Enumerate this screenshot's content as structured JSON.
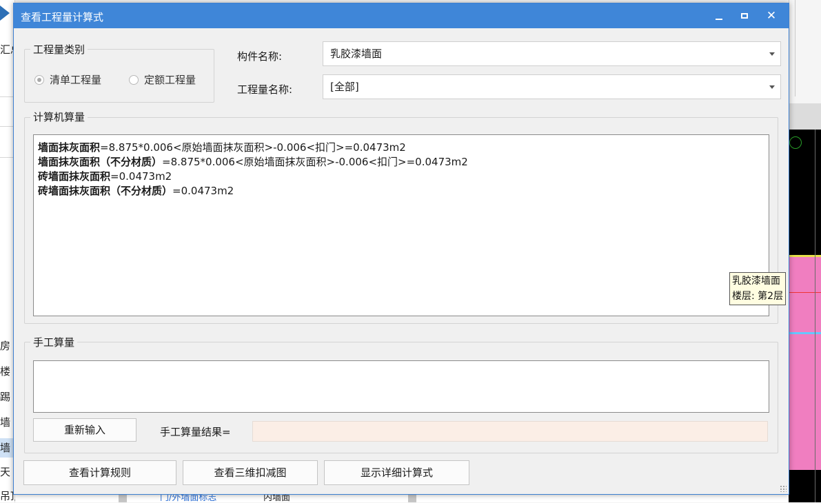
{
  "dialog": {
    "title": "查看工程量计算式",
    "controls": {
      "minimize": "minimize",
      "maximize": "maximize",
      "close": "✕"
    }
  },
  "quantity_type": {
    "group_label": "工程量类别",
    "options": [
      {
        "label": "清单工程量",
        "selected": true
      },
      {
        "label": "定额工程量",
        "selected": false
      }
    ]
  },
  "component_name": {
    "label": "构件名称:",
    "value": "乳胶漆墙面"
  },
  "quantity_name": {
    "label": "工程量名称:",
    "value": "[全部]"
  },
  "computer_calc": {
    "group_label": "计算机算量",
    "lines": [
      {
        "name": "墙面抹灰面积",
        "expr": "=8.875*0.006<原始墙面抹灰面积>-0.006<扣门>=0.0473m2"
      },
      {
        "name": "墙面抹灰面积（不分材质）",
        "expr": "=8.875*0.006<原始墙面抹灰面积>-0.006<扣门>=0.0473m2"
      },
      {
        "name": "砖墙面抹灰面积",
        "expr": "=0.0473m2"
      },
      {
        "name": "砖墙面抹灰面积（不分材质）",
        "expr": "=0.0473m2"
      }
    ]
  },
  "manual_calc": {
    "group_label": "手工算量",
    "input_value": "",
    "reenter_button": "重新输入",
    "result_label": "手工算量结果=",
    "result_value": ""
  },
  "footer_buttons": {
    "view_rules": "查看计算规则",
    "view_3d": "查看三维扣减图",
    "show_detail": "显示详细计算式"
  },
  "tooltip": {
    "line1": "乳胶漆墙面",
    "line2": "楼层: 第2层"
  },
  "background": {
    "left_fragments": [
      "汇总",
      "房",
      "楼",
      "踢",
      "墙",
      "墙",
      "天",
      "吊顶(K)"
    ],
    "bottom_fragments": [
      "门/外墙面标志",
      "内墙面"
    ]
  },
  "colors": {
    "title_bar": "#3f86d8",
    "dialog_bg": "#f0f0f0",
    "result_box": "#fbeee6",
    "canvas_pink": "#f07ec0",
    "tooltip_bg": "#fffde1"
  }
}
